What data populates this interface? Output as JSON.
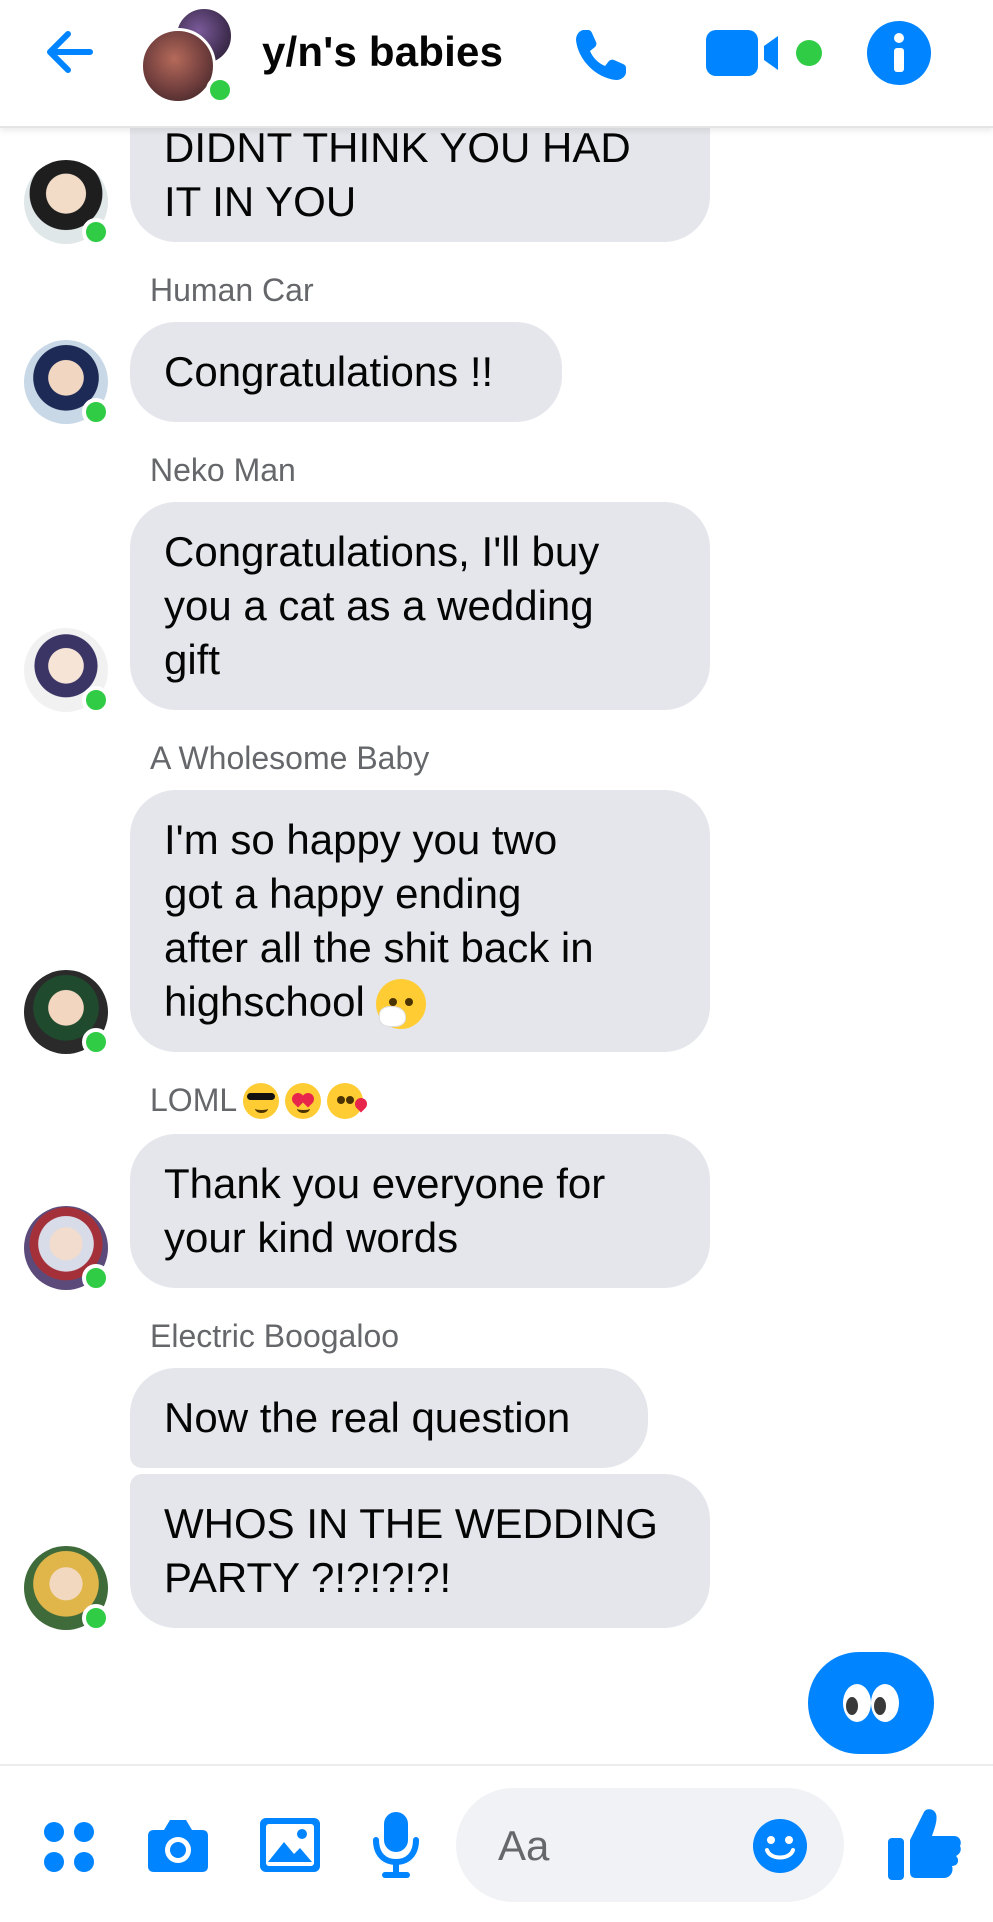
{
  "header": {
    "title": "y/n's babies",
    "back_icon": "back-arrow-icon",
    "phone_icon": "phone-icon",
    "video_icon": "video-camera-icon",
    "info_icon": "info-icon"
  },
  "messages": [
    {
      "sender": "",
      "text": "DIDNT THINK YOU HAD\nIT IN YOU"
    },
    {
      "sender": "Human Car",
      "text": "Congratulations !!"
    },
    {
      "sender": "Neko Man",
      "text": "Congratulations, I'll buy\nyou a cat as a wedding\ngift"
    },
    {
      "sender": "A Wholesome Baby",
      "text": "I'm so happy you two\ngot a happy ending\nafter all the shit back in\nhighschool",
      "emoji": "sneezing-face-emoji"
    },
    {
      "sender": "LOML",
      "sender_emojis": [
        "sunglasses-face-emoji",
        "heart-eyes-emoji",
        "kissing-face-emoji"
      ],
      "text": "Thank you everyone for\nyour kind words"
    },
    {
      "sender": "Electric Boogaloo",
      "text": "Now the real question"
    },
    {
      "sender": "",
      "text": "WHOS IN THE WEDDING\nPARTY ?!?!?!?!"
    }
  ],
  "outgoing_reaction": {
    "icon": "eyes-emoji",
    "color": "#0084ff"
  },
  "composer": {
    "placeholder": "Aa",
    "value": "",
    "icons": [
      "more-actions-icon",
      "camera-icon",
      "gallery-icon",
      "microphone-icon",
      "emoji-icon",
      "thumbs-up-icon"
    ]
  },
  "colors": {
    "accent": "#0084ff",
    "online": "#31cc46",
    "bubble": "#e4e6eb",
    "sender_text": "#65676b"
  }
}
